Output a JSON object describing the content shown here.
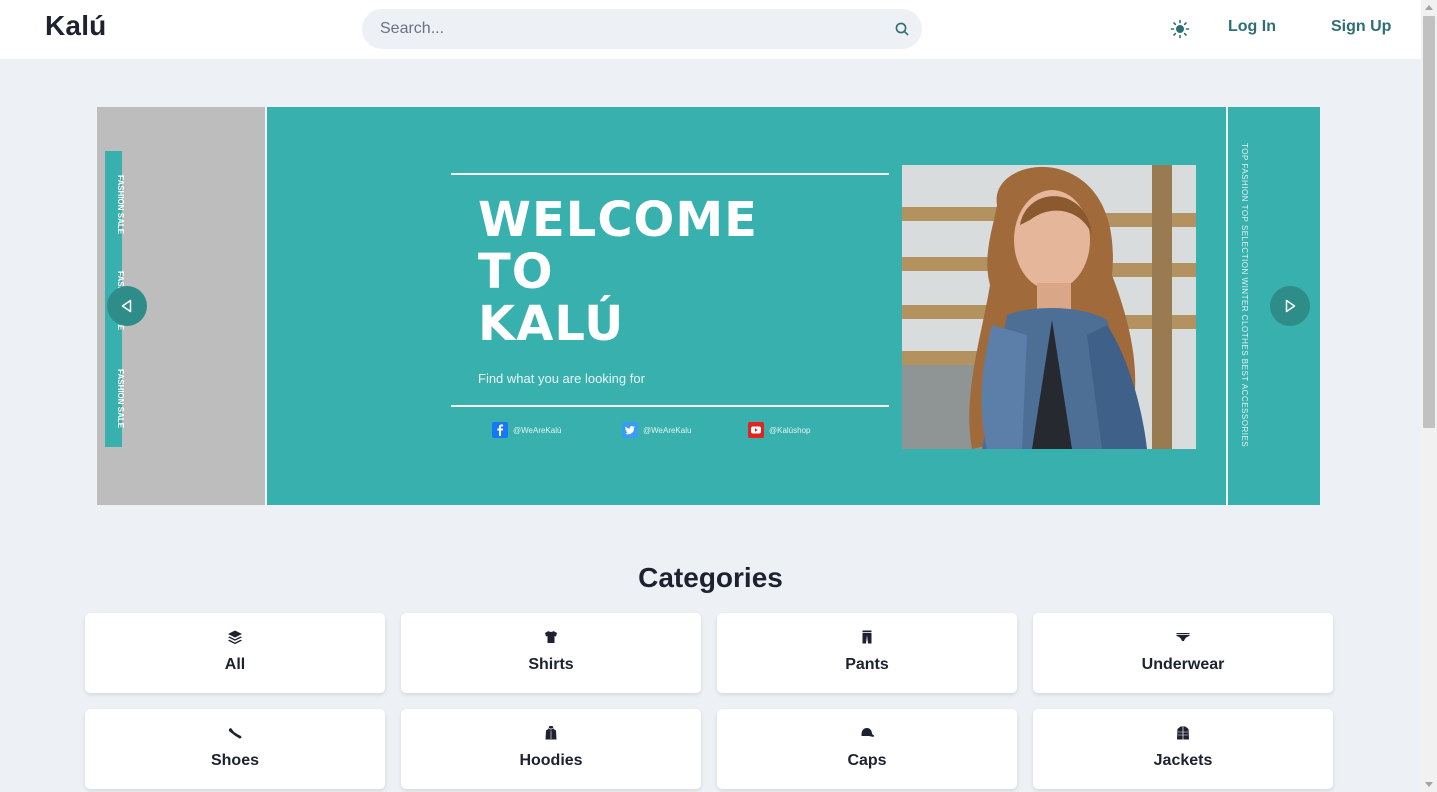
{
  "header": {
    "brand": "Kalú",
    "search_placeholder": "Search...",
    "login_label": "Log In",
    "signup_label": "Sign Up"
  },
  "hero": {
    "prev_slide_strip": [
      "FASHION SALE",
      "FASHION SALE",
      "FASHION SALE"
    ],
    "headline": "WELCOME\nTO\nKALÚ",
    "tagline": "Find what you are looking for",
    "socials": [
      {
        "icon": "facebook-icon",
        "handle": "@WeAreKalú",
        "color": "#1877f2"
      },
      {
        "icon": "twitter-icon",
        "handle": "@WeAreKalu",
        "color": "#3a9df2"
      },
      {
        "icon": "youtube-icon",
        "handle": "@Kalúshop",
        "color": "#e02424"
      }
    ],
    "next_slide_text": "TOP FASHION   TOP SELECTION   WINTER CLOTHES   BEST ACCESSORIES"
  },
  "categories": {
    "title": "Categories",
    "items": [
      {
        "label": "All",
        "icon": "layers-icon"
      },
      {
        "label": "Shirts",
        "icon": "shirt-icon"
      },
      {
        "label": "Pants",
        "icon": "pants-icon"
      },
      {
        "label": "Underwear",
        "icon": "underwear-icon"
      },
      {
        "label": "Shoes",
        "icon": "shoe-icon"
      },
      {
        "label": "Hoodies",
        "icon": "hoodie-icon"
      },
      {
        "label": "Caps",
        "icon": "cap-icon"
      },
      {
        "label": "Jackets",
        "icon": "jacket-icon"
      }
    ]
  },
  "colors": {
    "accent": "#38b0ad",
    "link": "#2e6f73",
    "page_bg": "#edf1f5"
  }
}
